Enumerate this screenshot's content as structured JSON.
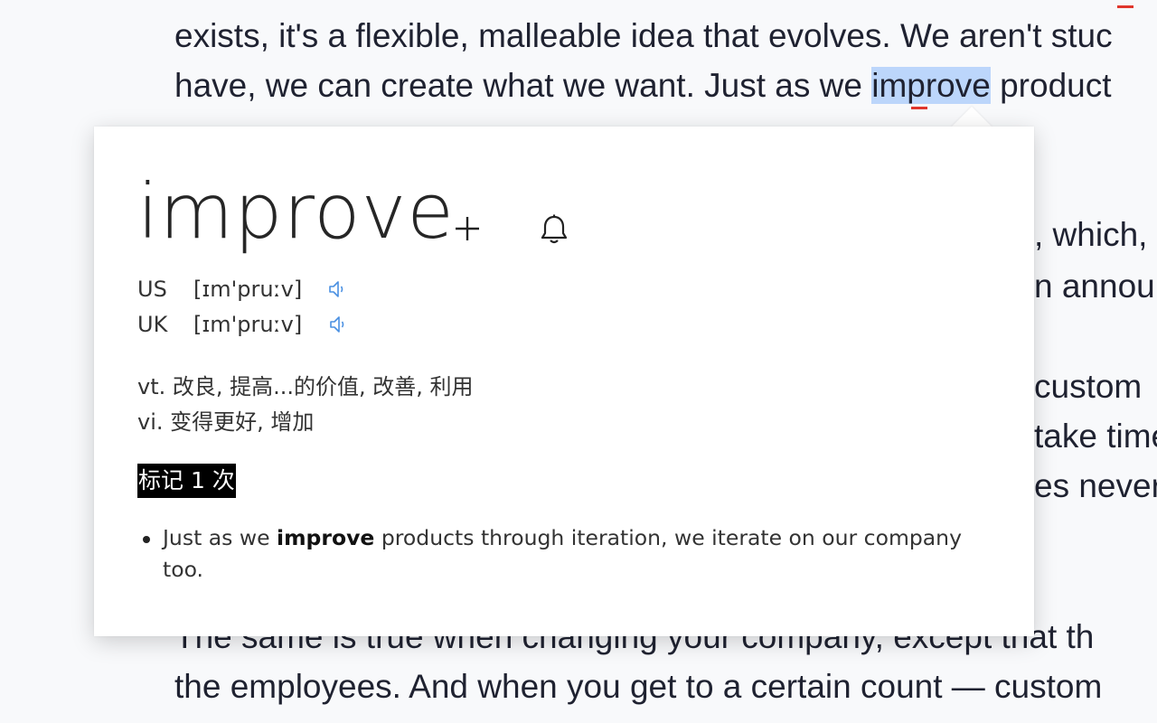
{
  "article": {
    "line1": "exists, it's a flexible, malleable idea that evolves. We aren't stuc",
    "line2_pre": "have, we can create what we want. Just as we ",
    "line2_highlight": "improve",
    "line2_post": " product",
    "right_fragments": [
      ", which,",
      "n annou",
      " custom",
      "take time",
      "es never"
    ],
    "bottom_line1": "The same is true when changing your company, except that th",
    "bottom_line2": "the employees. And when you get to a certain count — custom"
  },
  "popup": {
    "headword": "improve",
    "add_icon": "plus-icon",
    "bell_icon": "bell-icon",
    "pronunciations": [
      {
        "region": "US",
        "ipa": "[ɪm'pruːv]",
        "icon": "speaker-icon"
      },
      {
        "region": "UK",
        "ipa": "[ɪm'pruːv]",
        "icon": "speaker-icon"
      }
    ],
    "definitions": [
      "vt. 改良, 提高...的价值, 改善, 利用",
      "vi. 变得更好, 增加"
    ],
    "mark_count_label": "标记 1 次",
    "examples": [
      {
        "pre": "Just as we ",
        "bold": "improve",
        "post": " products through iteration, we iterate on our company too."
      }
    ],
    "colors": {
      "speaker": "#4a90e2",
      "badge_bg": "#000000",
      "highlight": "#bcd6fb",
      "spell_underline": "#e0362c"
    }
  }
}
